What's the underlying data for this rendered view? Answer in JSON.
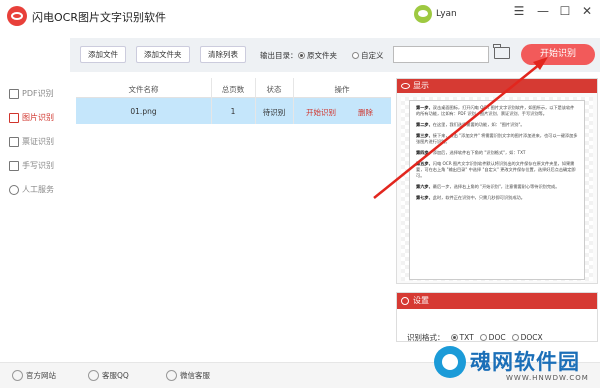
{
  "app": {
    "title": "闪电OCR图片文字识别软件",
    "user_name": "Lyan"
  },
  "window_controls": {
    "menu": "☰",
    "minimize": "—",
    "maximize": "☐",
    "close": "✕"
  },
  "sidebar": {
    "items": [
      {
        "label": "PDF识别",
        "icon": "pdf-icon",
        "active": false
      },
      {
        "label": "图片识别",
        "icon": "image-icon",
        "active": true
      },
      {
        "label": "票证识别",
        "icon": "id-card-icon",
        "active": false
      },
      {
        "label": "手写识别",
        "icon": "handwriting-icon",
        "active": false
      },
      {
        "label": "人工服务",
        "icon": "smile-icon",
        "active": false
      }
    ]
  },
  "toolbar": {
    "add_file": "添加文件",
    "add_folder": "添加文件夹",
    "clear_list": "清除列表",
    "output_label": "输出目录：",
    "radio_original": "原文件夹",
    "radio_custom": "自定义",
    "path_value": "",
    "start_button": "开始识别"
  },
  "table": {
    "headers": [
      "文件名称",
      "总页数",
      "状态",
      "操作"
    ],
    "rows": [
      {
        "name": "01.png",
        "pages": "1",
        "status": "待识别",
        "action_start": "开始识别",
        "action_delete": "删除"
      }
    ]
  },
  "preview": {
    "title": "显示",
    "paragraphs": [
      {
        "lead": "第一步、",
        "text": "双击桌面图标，打开闪电 OCR 图片文字识别软件，如图所示，以下是该软件的所有功能，比如有：PDF 识别、图片识别、票证识别、手写识别等。"
      },
      {
        "lead": "第二步、",
        "text": "在这里，我们选择需要的功能，如：\"图片识别\"。"
      },
      {
        "lead": "第三步、",
        "text": "接下来，点击 \"添加文件\" 将需要识别文字的图片添加进来，也可以一键添加多张图片进行识别。"
      },
      {
        "lead": "第四步、",
        "text": "添加后，选择软件右下角的 \"识别格式\"，如：TXT"
      },
      {
        "lead": "第五步、",
        "text": "闪电 OCR 图片文字识别软件默认将识别出的文件保存在原文件夹里，如果需要，可在右上角 \"输出目录\" 中选择 \"自定义\" 更改文件保存位置，选择好后点击确定即可。"
      },
      {
        "lead": "第六步、",
        "text": "最后一步，选择右上角的 \"开始识别\"，注意需要耐心等待识别完成。"
      },
      {
        "lead": "第七步、",
        "text": "此时，软件正在识别中，只需几秒即可识别成功。"
      }
    ]
  },
  "settings": {
    "title": "设置",
    "format_label": "识别格式：",
    "options": [
      {
        "label": "TXT",
        "selected": true
      },
      {
        "label": "DOC",
        "selected": false
      },
      {
        "label": "DOCX",
        "selected": false
      }
    ]
  },
  "footer": {
    "website": "官方网站",
    "qq": "客服QQ",
    "wechat": "微信客服"
  },
  "watermark": {
    "text": "魂网软件园",
    "url": "WWW.HNWDW.COM"
  },
  "colors": {
    "accent": "#d63a33",
    "button_red": "#f25a5a",
    "row_selected": "#c5e6fb",
    "toolbar_bg": "#eef1f4"
  }
}
